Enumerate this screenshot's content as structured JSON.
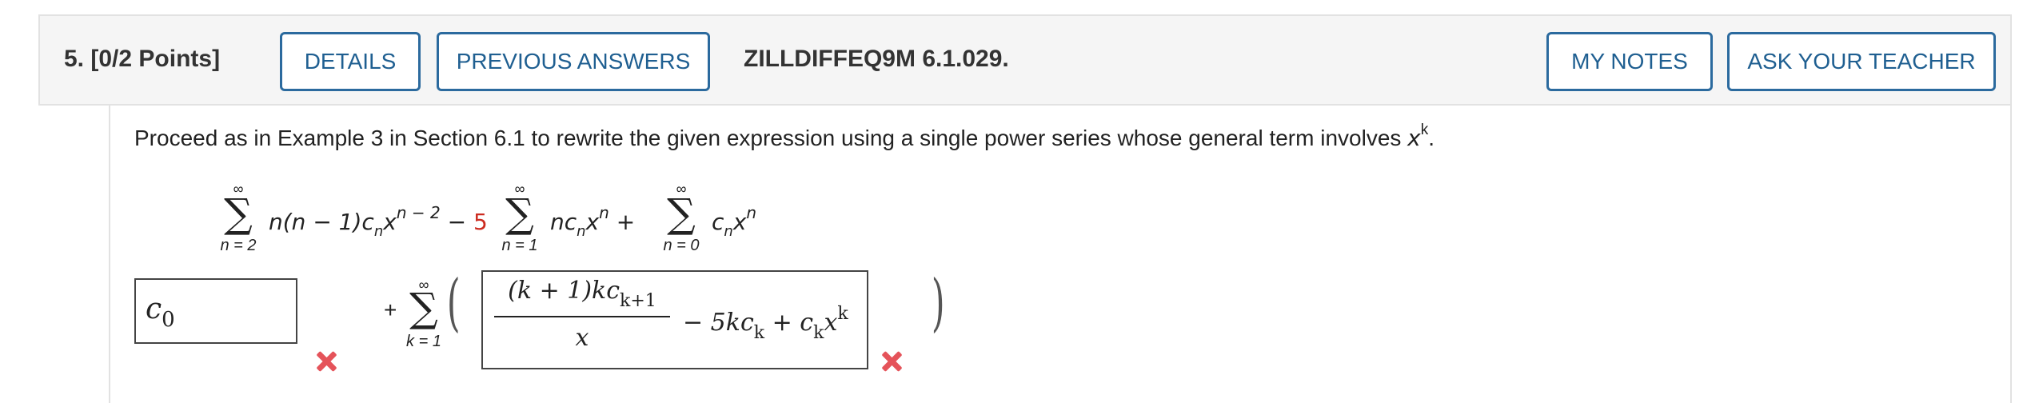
{
  "header": {
    "question_number": "5.",
    "points": "[0/2 Points]",
    "details_label": "DETAILS",
    "previous_answers_label": "PREVIOUS ANSWERS",
    "problem_code": "ZILLDIFFEQ9M 6.1.029.",
    "my_notes_label": "MY NOTES",
    "ask_teacher_label": "ASK YOUR TEACHER"
  },
  "prompt": {
    "text": "Proceed as in Example 3 in Section 6.1 to rewrite the given expression using a single power series whose general term involves ",
    "var": "x",
    "power": "k",
    "end": "."
  },
  "expression": {
    "sum1": {
      "upper": "∞",
      "lower": "n = 2",
      "term": "n(n − 1)c",
      "sub": "n",
      "base": "x",
      "power": "n − 2",
      "op": " −"
    },
    "coef": "5",
    "sum2": {
      "upper": "∞",
      "lower": "n = 1",
      "term": "nc",
      "sub": "n",
      "base": "x",
      "power": "n",
      "op": " +"
    },
    "sum3": {
      "upper": "∞",
      "lower": "n = 0",
      "term": "c",
      "sub": "n",
      "base": "x",
      "power": "n"
    }
  },
  "answer": {
    "input1": {
      "value": "c",
      "sub": "0",
      "status": "incorrect"
    },
    "plus": "+",
    "sum": {
      "upper": "∞",
      "lower": "k = 1"
    },
    "input2": {
      "numerator": "(k + 1)kc",
      "numerator_sub": "k+1",
      "denominator": "x",
      "rest": "− 5kc",
      "rest_sub": "k",
      "rest2": " + c",
      "rest2_sub": "k",
      "rest3": "x",
      "rest3_sup": "k",
      "status": "incorrect"
    },
    "colors": {
      "incorrect": "#e5535a",
      "button_border": "#2b6a9e",
      "highlight_coef": "#cc2b20"
    }
  }
}
